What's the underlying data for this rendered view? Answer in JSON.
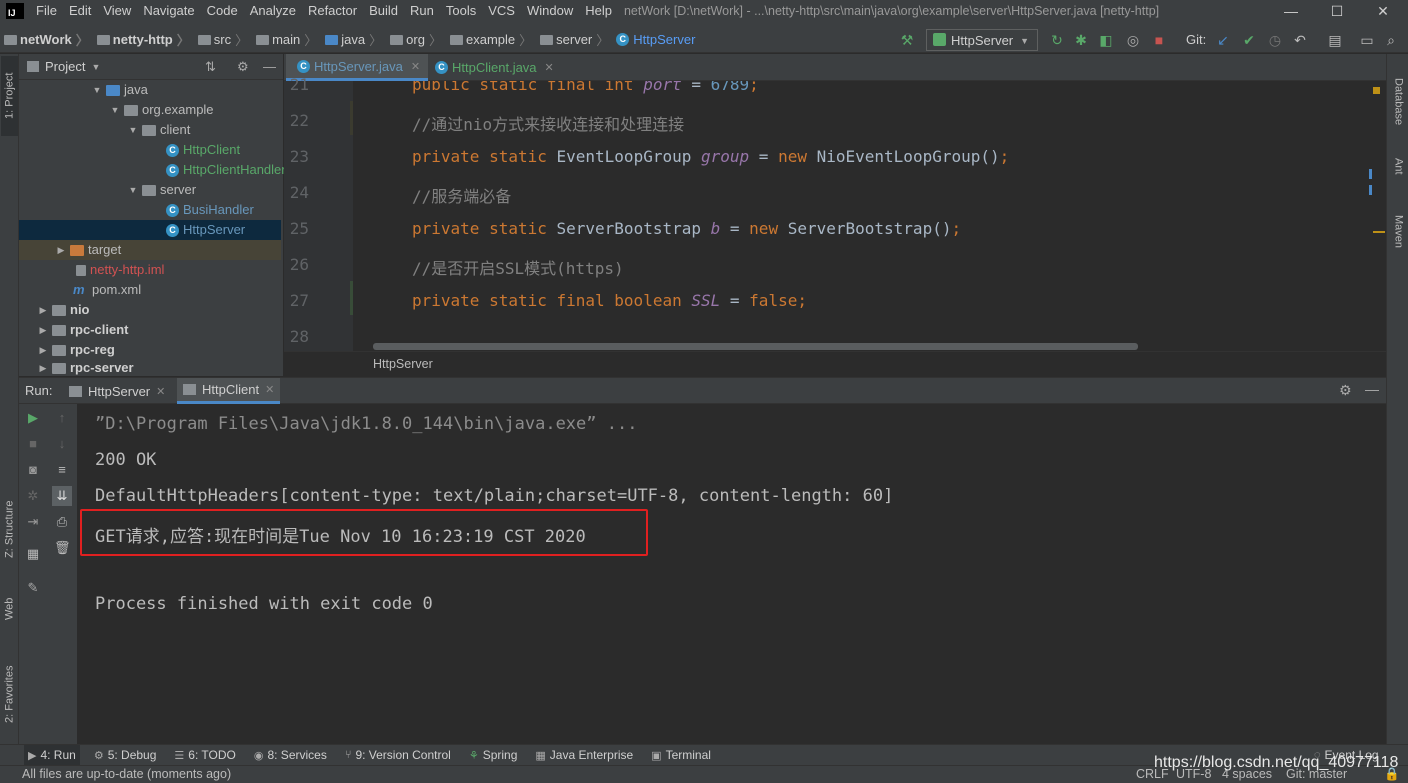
{
  "menubar": {
    "logo": "IJ",
    "items": [
      "File",
      "Edit",
      "View",
      "Navigate",
      "Code",
      "Analyze",
      "Refactor",
      "Build",
      "Run",
      "Tools",
      "VCS",
      "Window",
      "Help"
    ],
    "title": "netWork [D:\\netWork] - ...\\netty-http\\src\\main\\java\\org\\example\\server\\HttpServer.java [netty-http]",
    "minimize": "—",
    "maximize": "☐",
    "close": "✕"
  },
  "navbar": {
    "crumbs": [
      "netWork",
      "netty-http",
      "src",
      "main",
      "java",
      "org",
      "example",
      "server",
      "HttpServer"
    ],
    "run_config": "HttpServer",
    "git_label": "Git:"
  },
  "left_strip": {
    "project": "1: Project",
    "structure": "Z: Structure",
    "web": "Web",
    "favorites": "2: Favorites"
  },
  "right_strip": {
    "database": "Database",
    "ant": "Ant",
    "maven": "Maven"
  },
  "project": {
    "header": "Project",
    "tree": [
      {
        "label": "java",
        "type": "folder-blue",
        "open": true
      },
      {
        "label": "org.example",
        "type": "package",
        "open": true
      },
      {
        "label": "client",
        "type": "package",
        "open": true
      },
      {
        "label": "HttpClient",
        "type": "class"
      },
      {
        "label": "HttpClientHandler",
        "type": "class"
      },
      {
        "label": "server",
        "type": "package",
        "open": true
      },
      {
        "label": "BusiHandler",
        "type": "class"
      },
      {
        "label": "HttpServer",
        "type": "class",
        "selected": true
      },
      {
        "label": "target",
        "type": "folder-orange",
        "open": false
      },
      {
        "label": "netty-http.iml",
        "type": "iml"
      },
      {
        "label": "pom.xml",
        "type": "maven"
      },
      {
        "label": "nio",
        "type": "module",
        "open": false
      },
      {
        "label": "rpc-client",
        "type": "module",
        "open": false
      },
      {
        "label": "rpc-reg",
        "type": "module",
        "open": false
      },
      {
        "label": "rpc-server",
        "type": "module",
        "open": false
      }
    ]
  },
  "editor": {
    "tabs": [
      {
        "label": "HttpServer.java",
        "active": true
      },
      {
        "label": "HttpClient.java",
        "active": false
      }
    ],
    "line_numbers": [
      "21",
      "22",
      "23",
      "24",
      "25",
      "26",
      "27",
      "28"
    ],
    "lines": {
      "l21": [
        "public static final int ",
        "port",
        " = ",
        "6789",
        ";"
      ],
      "l22": "//通过nio方式来接收连接和处理连接",
      "l23": [
        "private static ",
        "EventLoopGroup ",
        "group",
        " = ",
        "new ",
        "NioEventLoopGroup()",
        ";"
      ],
      "l24": "//服务端必备",
      "l25": [
        "private static ",
        "ServerBootstrap ",
        "b",
        " = ",
        "new ",
        "ServerBootstrap()",
        ";"
      ],
      "l26": "//是否开启SSL模式(https)",
      "l27": [
        "private static final boolean ",
        "SSL",
        " = ",
        "false",
        ";"
      ]
    },
    "breadcrumb": "HttpServer"
  },
  "run": {
    "label": "Run:",
    "tabs": [
      {
        "label": "HttpServer",
        "active": false
      },
      {
        "label": "HttpClient",
        "active": true
      }
    ],
    "console": [
      "”D:\\Program Files\\Java\\jdk1.8.0_144\\bin\\java.exe” ...",
      "200 OK",
      "DefaultHttpHeaders[content-type: text/plain;charset=UTF-8, content-length: 60]",
      "GET请求,应答:现在时间是Tue Nov 10 16:23:19 CST 2020",
      "",
      "Process finished with exit code 0"
    ]
  },
  "bottom_tools": [
    {
      "label": "4: Run",
      "icon": "▶",
      "active": true
    },
    {
      "label": "5: Debug",
      "icon": "⚙"
    },
    {
      "label": "6: TODO",
      "icon": "☰"
    },
    {
      "label": "8: Services",
      "icon": "◉"
    },
    {
      "label": "9: Version Control",
      "icon": "⑂"
    },
    {
      "label": "Spring",
      "icon": "⚘"
    },
    {
      "label": "Java Enterprise",
      "icon": "▦"
    },
    {
      "label": "Terminal",
      "icon": "▣"
    }
  ],
  "status": {
    "message": "All files are up-to-date (moments ago)",
    "event_log": "Event Log",
    "line_sep": "CRLF",
    "encoding": "UTF-8",
    "indent": "4 spaces",
    "git": "Git: master"
  },
  "watermark": "https://blog.csdn.net/qq_40977118"
}
